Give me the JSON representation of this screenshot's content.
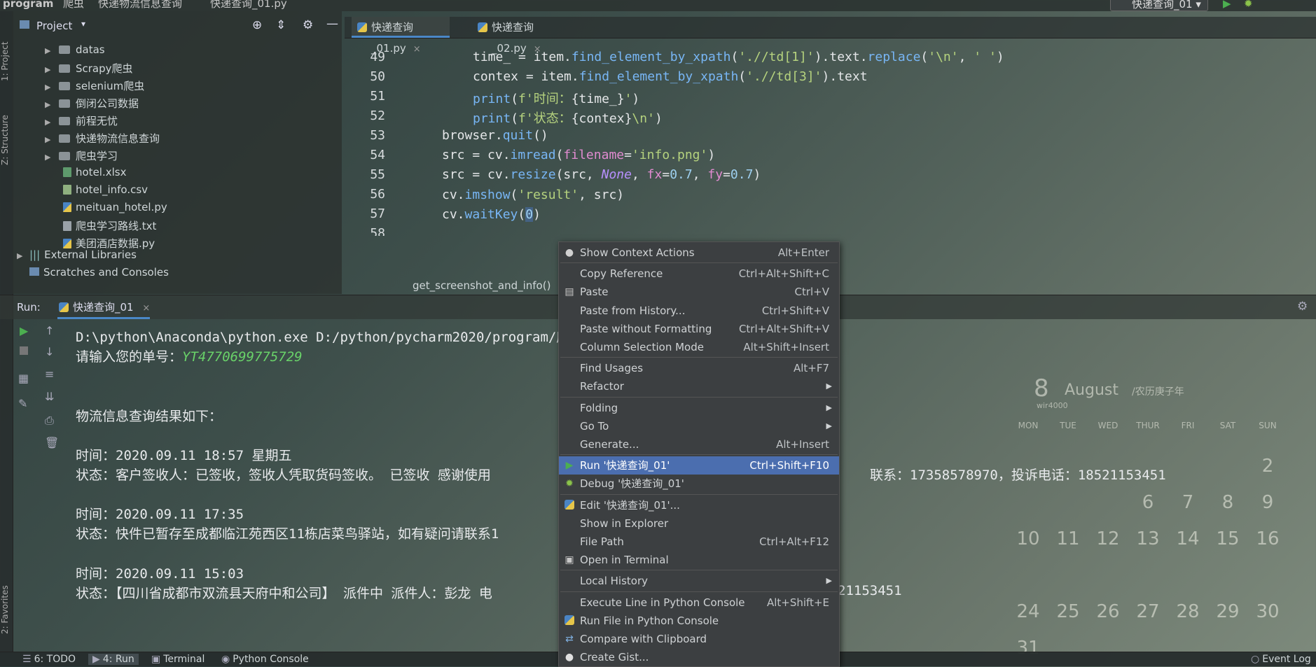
{
  "breadcrumb": {
    "items": [
      "program",
      "爬虫",
      "快递物流信息查询",
      "快递查询_01.py"
    ]
  },
  "run_config": {
    "selected": "快递查询_01"
  },
  "left_strip": {
    "project": "1: Project",
    "structure": "Z: Structure",
    "favorites": "2: Favorites"
  },
  "project_pane": {
    "title": "Project",
    "items": [
      {
        "label": "datas",
        "kind": "folder"
      },
      {
        "label": "Scrapy爬虫",
        "kind": "folder"
      },
      {
        "label": "selenium爬虫",
        "kind": "folder"
      },
      {
        "label": "倒闭公司数据",
        "kind": "folder"
      },
      {
        "label": "前程无忧",
        "kind": "folder"
      },
      {
        "label": "快递物流信息查询",
        "kind": "folder"
      },
      {
        "label": "爬虫学习",
        "kind": "folder"
      },
      {
        "label": "hotel.xlsx",
        "kind": "xlsx"
      },
      {
        "label": "hotel_info.csv",
        "kind": "csv"
      },
      {
        "label": "meituan_hotel.py",
        "kind": "py"
      },
      {
        "label": "爬虫学习路线.txt",
        "kind": "txt"
      },
      {
        "label": "美团酒店数据.py",
        "kind": "py"
      }
    ],
    "external_libraries": "External Libraries",
    "scratches": "Scratches and Consoles"
  },
  "editor": {
    "tabs": [
      {
        "label": "快递查询_01.py",
        "active": true
      },
      {
        "label": "快递查询_02.py",
        "active": false
      }
    ],
    "line_numbers": [
      "49",
      "50",
      "51",
      "52",
      "53",
      "54",
      "55",
      "56",
      "57",
      "58"
    ],
    "breadcrumb_function": "get_screenshot_and_info()"
  },
  "run_panel": {
    "label": "Run:",
    "tab": "快递查询_01",
    "output": {
      "cmd": "D:\\python\\Anaconda\\python.exe D:/python/pycharm2020/program/爬",
      "prompt": "请输入您的单号：",
      "tracking_no": "YT4770699775729",
      "result_title": "物流信息查询结果如下：",
      "t1": "时间：2020.09.11 18:57 星期五",
      "s1": "状态：客户签收人：已签收，签收人凭取货码签收。 已签收 感谢使用",
      "s1_tail": "联系：17358578970，投诉电话：18521153451",
      "t2": "时间：2020.09.11 17:35",
      "s2": "状态：快件已暂存至成都临江苑西区11栋店菜鸟驿站，如有疑问请联系1",
      "t3": "时间：2020.09.11 15:03",
      "s3": "状态：【四川省成都市双流县天府中和公司】 派件中 派件人：彭龙 电",
      "s3_tail": "21153451"
    }
  },
  "calendar": {
    "day": "8",
    "month": "August",
    "lunar": "/农历庚子年",
    "sub": "wir4000",
    "weekdays": [
      "MON",
      "TUE",
      "WED",
      "THUR",
      "FRI",
      "SAT",
      "SUN"
    ],
    "dates": [
      "2",
      "6",
      "7",
      "8",
      "9",
      "10",
      "11",
      "12",
      "13",
      "14",
      "15",
      "16",
      "24",
      "25",
      "26",
      "27",
      "28",
      "29",
      "30",
      "31"
    ]
  },
  "bottom_bar": {
    "todo": "6: TODO",
    "run": "4: Run",
    "terminal": "Terminal",
    "python_console": "Python Console",
    "event_log": "Event Log"
  },
  "context_menu": {
    "items": [
      {
        "label": "Show Context Actions",
        "shortcut": "Alt+Enter",
        "icon": "bulb-icon"
      },
      {
        "label": "Copy Reference",
        "shortcut": "Ctrl+Alt+Shift+C"
      },
      {
        "label": "Paste",
        "shortcut": "Ctrl+V",
        "icon": "clipboard-icon"
      },
      {
        "label": "Paste from History...",
        "shortcut": "Ctrl+Shift+V"
      },
      {
        "label": "Paste without Formatting",
        "shortcut": "Ctrl+Alt+Shift+V"
      },
      {
        "label": "Column Selection Mode",
        "shortcut": "Alt+Shift+Insert"
      },
      {
        "label": "Find Usages",
        "shortcut": "Alt+F7"
      },
      {
        "label": "Refactor",
        "shortcut": ""
      },
      {
        "label": "Folding",
        "shortcut": ""
      },
      {
        "label": "Go To",
        "shortcut": ""
      },
      {
        "label": "Generate...",
        "shortcut": "Alt+Insert"
      },
      {
        "label": "Run '快递查询_01'",
        "shortcut": "Ctrl+Shift+F10",
        "icon": "run-icon"
      },
      {
        "label": "Debug '快递查询_01'",
        "shortcut": "",
        "icon": "debug-icon"
      },
      {
        "label": "Edit '快递查询_01'...",
        "shortcut": "",
        "icon": "python-icon"
      },
      {
        "label": "Show in Explorer",
        "shortcut": ""
      },
      {
        "label": "File Path",
        "shortcut": "Ctrl+Alt+F12"
      },
      {
        "label": "Open in Terminal",
        "shortcut": "",
        "icon": "terminal-icon"
      },
      {
        "label": "Local History",
        "shortcut": ""
      },
      {
        "label": "Execute Line in Python Console",
        "shortcut": "Alt+Shift+E"
      },
      {
        "label": "Run File in Python Console",
        "shortcut": "",
        "icon": "python-icon"
      },
      {
        "label": "Compare with Clipboard",
        "shortcut": "",
        "icon": "compare-icon"
      },
      {
        "label": "Create Gist...",
        "shortcut": "",
        "icon": "github-icon"
      }
    ]
  },
  "colors": {
    "accent": "#4b6eaf",
    "menu_bg": "#3c3f41",
    "string": "#b5d27e",
    "function": "#78b6f5",
    "console_input": "#69d269"
  }
}
